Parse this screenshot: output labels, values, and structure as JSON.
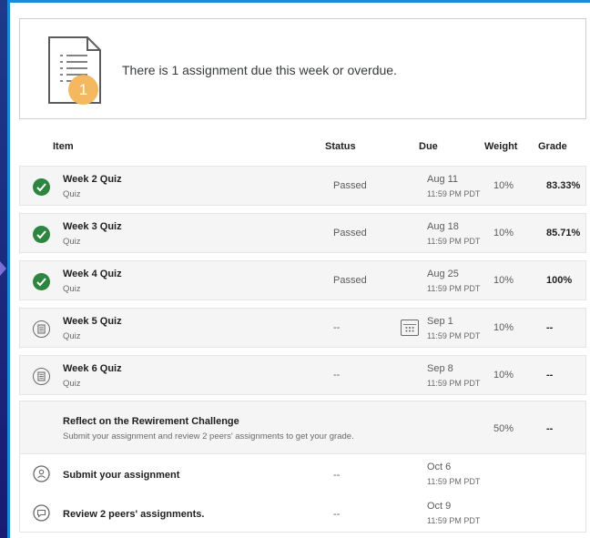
{
  "summary": {
    "text": "There is 1 assignment due this week or overdue.",
    "badge_count": "1"
  },
  "table": {
    "headers": {
      "item": "Item",
      "status": "Status",
      "due": "Due",
      "weight": "Weight",
      "grade": "Grade"
    },
    "rows": [
      {
        "title": "Week 2 Quiz",
        "type": "Quiz",
        "status": "Passed",
        "due_date": "Aug 11",
        "due_time": "11:59 PM PDT",
        "weight": "10%",
        "grade": "83.33%",
        "icon": "check-circle-icon"
      },
      {
        "title": "Week 3 Quiz",
        "type": "Quiz",
        "status": "Passed",
        "due_date": "Aug 18",
        "due_time": "11:59 PM PDT",
        "weight": "10%",
        "grade": "85.71%",
        "icon": "check-circle-icon"
      },
      {
        "title": "Week 4 Quiz",
        "type": "Quiz",
        "status": "Passed",
        "due_date": "Aug 25",
        "due_time": "11:59 PM PDT",
        "weight": "10%",
        "grade": "100%",
        "icon": "check-circle-icon"
      },
      {
        "title": "Week 5 Quiz",
        "type": "Quiz",
        "status": "--",
        "due_date": "Sep 1",
        "due_time": "11:59 PM PDT",
        "weight": "10%",
        "grade": "--",
        "icon": "quiz-icon"
      },
      {
        "title": "Week 6 Quiz",
        "type": "Quiz",
        "status": "--",
        "due_date": "Sep 8",
        "due_time": "11:59 PM PDT",
        "weight": "10%",
        "grade": "--",
        "icon": "quiz-icon"
      }
    ],
    "reflect": {
      "title": "Reflect on the Rewirement Challenge",
      "subtitle": "Submit your assignment and review 2 peers' assignments to get your grade.",
      "weight": "50%",
      "grade": "--",
      "steps": [
        {
          "title": "Submit your assignment",
          "status": "--",
          "due_date": "Oct 6",
          "due_time": "11:59 PM PDT",
          "icon": "submit-icon"
        },
        {
          "title": "Review 2 peers' assignments.",
          "status": "--",
          "due_date": "Oct 9",
          "due_time": "11:59 PM PDT",
          "icon": "review-icon"
        }
      ]
    }
  },
  "colors": {
    "accent_border": "#1f8bd6",
    "check_green": "#2e8540",
    "badge_orange": "#f4b860"
  }
}
